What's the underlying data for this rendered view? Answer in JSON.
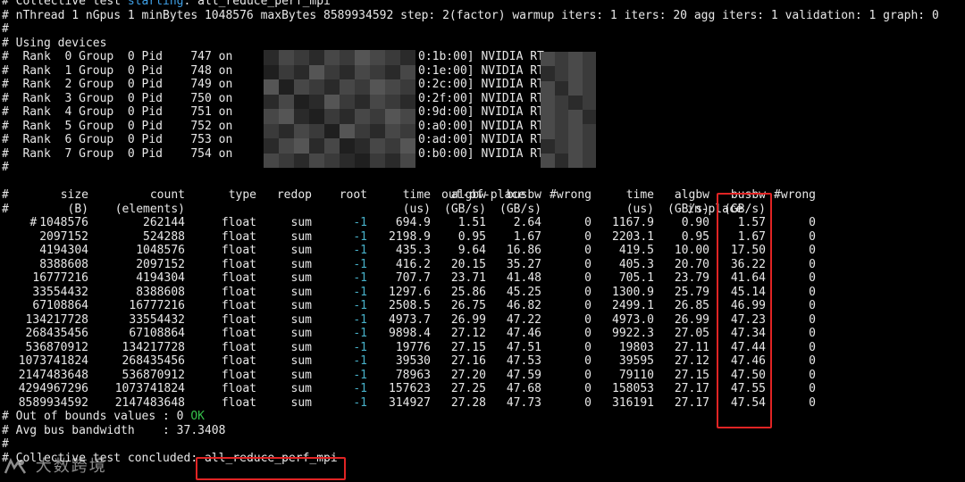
{
  "header": {
    "line1_prefix": "# Collective test ",
    "line1_starting": "starting",
    "line1_suffix": ": all_reduce_perf_mpi",
    "line2": "# nThread 1 nGpus 1 minBytes 1048576 maxBytes 8589934592 step: 2(factor) warmup iters: 1 iters: 20 agg iters: 1 validation: 1 graph: 0",
    "blank": "#",
    "using_devices": "# Using devices"
  },
  "devices": [
    {
      "prefix": "#  Rank  0 Group  0 Pid    747 on",
      "pci": "0:1b:00] NVIDIA RT"
    },
    {
      "prefix": "#  Rank  1 Group  0 Pid    748 on",
      "pci": "0:1e:00] NVIDIA RT"
    },
    {
      "prefix": "#  Rank  2 Group  0 Pid    749 on",
      "pci": "0:2c:00] NVIDIA RT"
    },
    {
      "prefix": "#  Rank  3 Group  0 Pid    750 on",
      "pci": "0:2f:00] NVIDIA RT"
    },
    {
      "prefix": "#  Rank  4 Group  0 Pid    751 on",
      "pci": "0:9d:00] NVIDIA RT"
    },
    {
      "prefix": "#  Rank  5 Group  0 Pid    752 on",
      "pci": "0:a0:00] NVIDIA RT"
    },
    {
      "prefix": "#  Rank  6 Group  0 Pid    753 on",
      "pci": "0:ad:00] NVIDIA RT"
    },
    {
      "prefix": "#  Rank  7 Group  0 Pid    754 on",
      "pci": "0:b0:00] NVIDIA RT"
    }
  ],
  "table_header": {
    "group_out": "out-of-place",
    "group_in": "in-place",
    "h1": [
      "size",
      "count",
      "type",
      "redop",
      "root",
      "time",
      "algbw",
      "busbw",
      "#wrong",
      "time",
      "algbw",
      "busbw",
      "#wrong"
    ],
    "h2": [
      "(B)",
      "(elements)",
      "",
      "",
      "",
      "(us)",
      "(GB/s)",
      "(GB/s)",
      "",
      "(us)",
      "(GB/s)",
      "(GB/s)",
      ""
    ]
  },
  "rows": [
    [
      "1048576",
      "262144",
      "float",
      "sum",
      "-1",
      "694.9",
      "1.51",
      "2.64",
      "0",
      "1167.9",
      "0.90",
      "1.57",
      "0"
    ],
    [
      "2097152",
      "524288",
      "float",
      "sum",
      "-1",
      "2198.9",
      "0.95",
      "1.67",
      "0",
      "2203.1",
      "0.95",
      "1.67",
      "0"
    ],
    [
      "4194304",
      "1048576",
      "float",
      "sum",
      "-1",
      "435.3",
      "9.64",
      "16.86",
      "0",
      "419.5",
      "10.00",
      "17.50",
      "0"
    ],
    [
      "8388608",
      "2097152",
      "float",
      "sum",
      "-1",
      "416.2",
      "20.15",
      "35.27",
      "0",
      "405.3",
      "20.70",
      "36.22",
      "0"
    ],
    [
      "16777216",
      "4194304",
      "float",
      "sum",
      "-1",
      "707.7",
      "23.71",
      "41.48",
      "0",
      "705.1",
      "23.79",
      "41.64",
      "0"
    ],
    [
      "33554432",
      "8388608",
      "float",
      "sum",
      "-1",
      "1297.6",
      "25.86",
      "45.25",
      "0",
      "1300.9",
      "25.79",
      "45.14",
      "0"
    ],
    [
      "67108864",
      "16777216",
      "float",
      "sum",
      "-1",
      "2508.5",
      "26.75",
      "46.82",
      "0",
      "2499.1",
      "26.85",
      "46.99",
      "0"
    ],
    [
      "134217728",
      "33554432",
      "float",
      "sum",
      "-1",
      "4973.7",
      "26.99",
      "47.22",
      "0",
      "4973.0",
      "26.99",
      "47.23",
      "0"
    ],
    [
      "268435456",
      "67108864",
      "float",
      "sum",
      "-1",
      "9898.4",
      "27.12",
      "47.46",
      "0",
      "9922.3",
      "27.05",
      "47.34",
      "0"
    ],
    [
      "536870912",
      "134217728",
      "float",
      "sum",
      "-1",
      "19776",
      "27.15",
      "47.51",
      "0",
      "19803",
      "27.11",
      "47.44",
      "0"
    ],
    [
      "1073741824",
      "268435456",
      "float",
      "sum",
      "-1",
      "39530",
      "27.16",
      "47.53",
      "0",
      "39595",
      "27.12",
      "47.46",
      "0"
    ],
    [
      "2147483648",
      "536870912",
      "float",
      "sum",
      "-1",
      "78963",
      "27.20",
      "47.59",
      "0",
      "79110",
      "27.15",
      "47.50",
      "0"
    ],
    [
      "4294967296",
      "1073741824",
      "float",
      "sum",
      "-1",
      "157623",
      "27.25",
      "47.68",
      "0",
      "158053",
      "27.17",
      "47.55",
      "0"
    ],
    [
      "8589934592",
      "2147483648",
      "float",
      "sum",
      "-1",
      "314927",
      "27.28",
      "47.73",
      "0",
      "316191",
      "27.17",
      "47.54",
      "0"
    ]
  ],
  "footer": {
    "out_of_bounds_prefix": "# Out of bounds values : 0 ",
    "out_of_bounds_ok": "OK",
    "avg_bus": "# Avg bus bandwidth    : 37.3408",
    "blank": "#",
    "concluded_prefix": "# Collective test concluded: ",
    "concluded_value": "all_reduce_perf_mpi"
  },
  "watermark": {
    "text": "大数跨境"
  },
  "colors": {
    "background": "#000000",
    "foreground": "#e8e8e8",
    "keyword_blue": "#3fa0e6",
    "root_cyan": "#47b0c8",
    "ok_green": "#35c04a",
    "highlight_red": "#e02424"
  }
}
